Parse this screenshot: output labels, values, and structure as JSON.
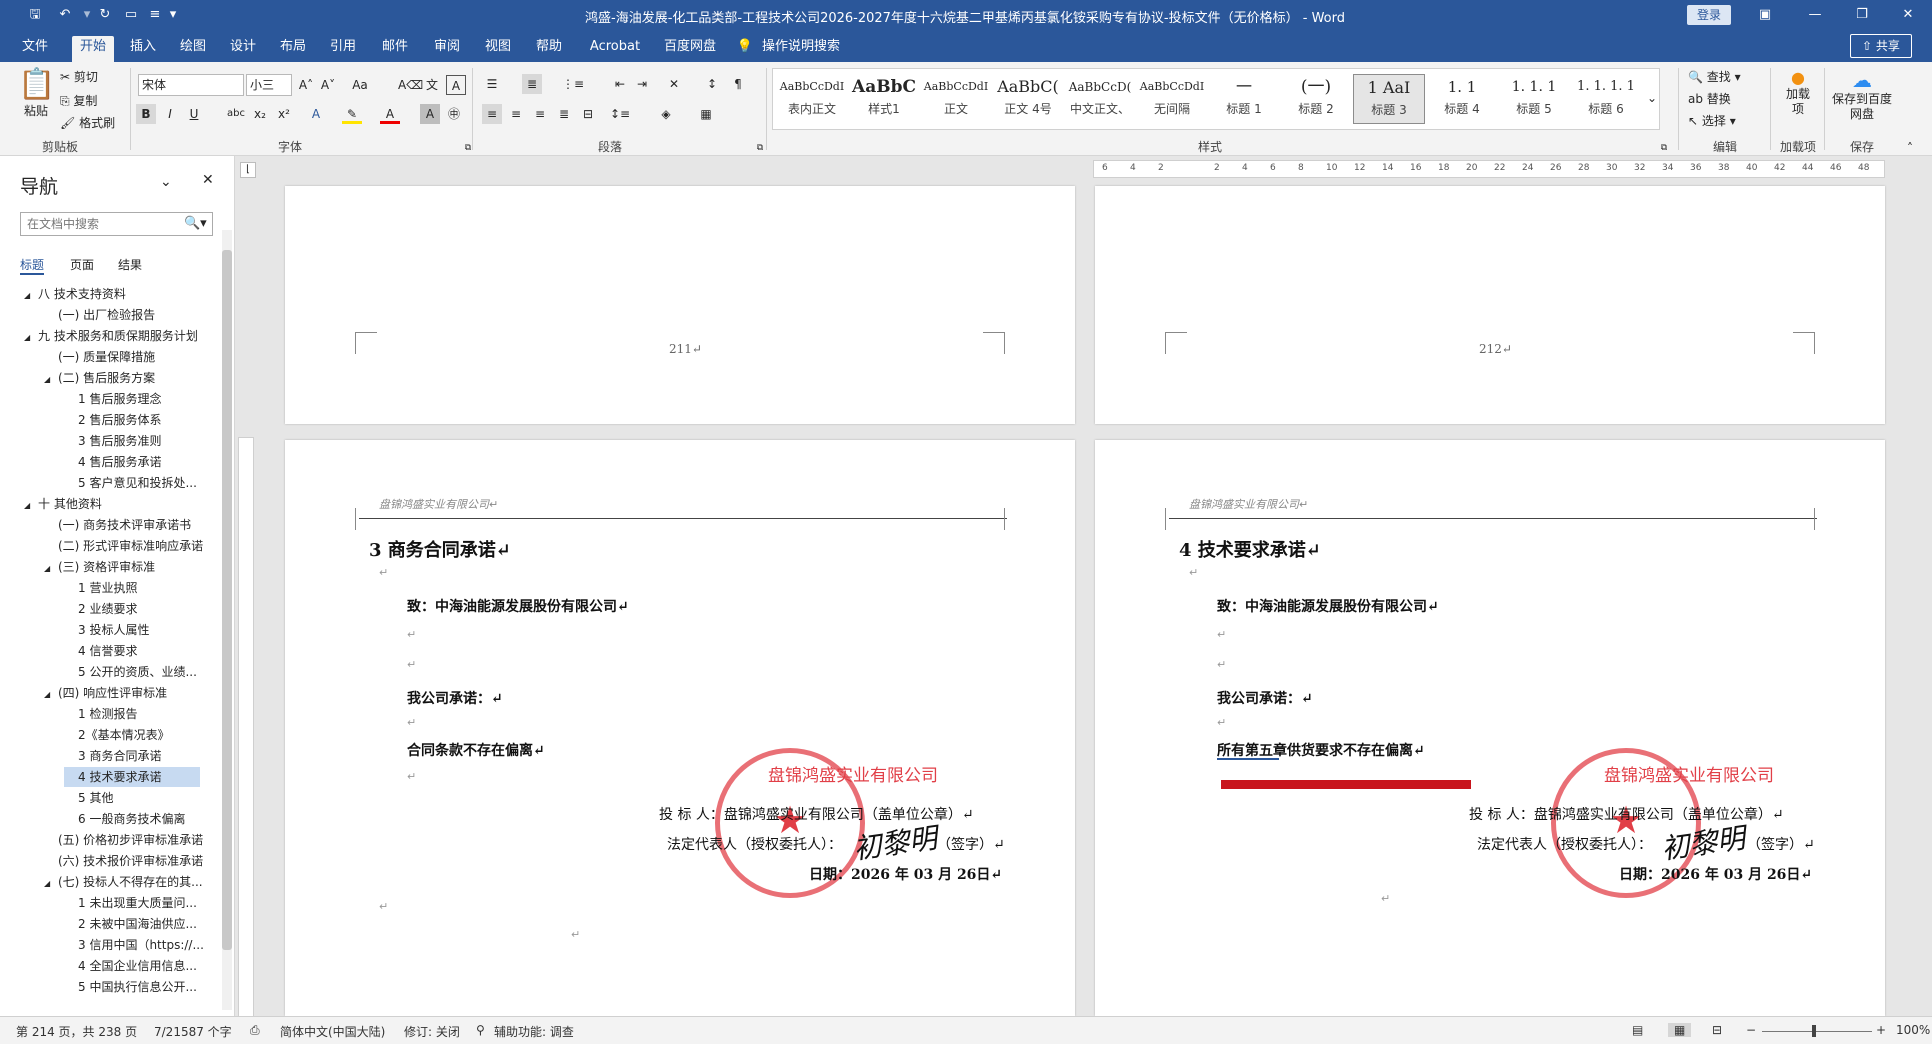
{
  "titlebar": {
    "title": "鸿盛-海油发展-化工品类部-工程技术公司2026-2027年度十六烷基二甲基烯丙基氯化铵采购专有协议-投标文件（无价格标） - Word",
    "login": "登录"
  },
  "tabs": [
    "文件",
    "开始",
    "插入",
    "绘图",
    "设计",
    "布局",
    "引用",
    "邮件",
    "审阅",
    "视图",
    "帮助",
    "Acrobat",
    "百度网盘"
  ],
  "tell_me": "操作说明搜索",
  "share": "共享",
  "clipboard": {
    "paste": "粘贴",
    "cut": "剪切",
    "copy": "复制",
    "format_painter": "格式刷",
    "label": "剪贴板"
  },
  "font": {
    "name": "宋体",
    "size": "小三",
    "label": "字体"
  },
  "paragraph": {
    "label": "段落"
  },
  "styles": {
    "label": "样式",
    "items": [
      {
        "sample": "AaBbCcDdI",
        "name": "表内正文"
      },
      {
        "sample": "AaBbC",
        "name": "样式1"
      },
      {
        "sample": "AaBbCcDdI",
        "name": "正文"
      },
      {
        "sample": "AaBbC(",
        "name": "正文 4号"
      },
      {
        "sample": "AaBbCcD(",
        "name": "中文正文、"
      },
      {
        "sample": "AaBbCcDdI",
        "name": "无间隔"
      },
      {
        "sample": "一",
        "name": "标题 1"
      },
      {
        "sample": "(一)",
        "name": "标题 2"
      },
      {
        "sample": "1  AaI",
        "name": "标题 3"
      },
      {
        "sample": "1. 1",
        "name": "标题 4"
      },
      {
        "sample": "1. 1. 1",
        "name": "标题 5"
      },
      {
        "sample": "1. 1. 1. 1",
        "name": "标题 6"
      }
    ]
  },
  "editing": {
    "find": "查找",
    "replace": "替换",
    "select": "选择",
    "label": "编辑"
  },
  "addins": {
    "name": "加载项",
    "label": "加载项"
  },
  "baidu": {
    "name": "保存到百度网盘",
    "label": "保存"
  },
  "nav": {
    "title": "导航",
    "search_placeholder": "在文档中搜索",
    "tabs": [
      "标题",
      "页面",
      "结果"
    ],
    "tree": [
      {
        "text": "八 技术支持资料",
        "indent": 0,
        "exp": "◢"
      },
      {
        "text": "(一) 出厂检验报告",
        "indent": 1,
        "exp": ""
      },
      {
        "text": "九 技术服务和质保期服务计划",
        "indent": 0,
        "exp": "◢"
      },
      {
        "text": "(一) 质量保障措施",
        "indent": 1,
        "exp": ""
      },
      {
        "text": "(二) 售后服务方案",
        "indent": 1,
        "exp": "◢"
      },
      {
        "text": "1 售后服务理念",
        "indent": 2,
        "exp": ""
      },
      {
        "text": "2 售后服务体系",
        "indent": 2,
        "exp": ""
      },
      {
        "text": "3 售后服务准则",
        "indent": 2,
        "exp": ""
      },
      {
        "text": "4 售后服务承诺",
        "indent": 2,
        "exp": ""
      },
      {
        "text": "5 客户意见和投拆处...",
        "indent": 2,
        "exp": ""
      },
      {
        "text": "十 其他资料",
        "indent": 0,
        "exp": "◢"
      },
      {
        "text": "(一) 商务技术评审承诺书",
        "indent": 1,
        "exp": ""
      },
      {
        "text": "(二) 形式评审标准响应承诺",
        "indent": 1,
        "exp": ""
      },
      {
        "text": "(三) 资格评审标准",
        "indent": 1,
        "exp": "◢"
      },
      {
        "text": "1 营业执照",
        "indent": 2,
        "exp": ""
      },
      {
        "text": "2 业绩要求",
        "indent": 2,
        "exp": ""
      },
      {
        "text": "3 投标人属性",
        "indent": 2,
        "exp": ""
      },
      {
        "text": "4 信誉要求",
        "indent": 2,
        "exp": ""
      },
      {
        "text": "5 公开的资质、业绩...",
        "indent": 2,
        "exp": ""
      },
      {
        "text": "(四) 响应性评审标准",
        "indent": 1,
        "exp": "◢"
      },
      {
        "text": "1 检测报告",
        "indent": 2,
        "exp": ""
      },
      {
        "text": "2《基本情况表》",
        "indent": 2,
        "exp": ""
      },
      {
        "text": "3 商务合同承诺",
        "indent": 2,
        "exp": ""
      },
      {
        "text": "4 技术要求承诺",
        "indent": 2,
        "exp": "",
        "selected": true
      },
      {
        "text": "5 其他",
        "indent": 2,
        "exp": ""
      },
      {
        "text": "6 一般商务技术偏离",
        "indent": 2,
        "exp": ""
      },
      {
        "text": "(五) 价格初步评审标准承诺",
        "indent": 1,
        "exp": ""
      },
      {
        "text": "(六) 技术报价评审标准承诺",
        "indent": 1,
        "exp": ""
      },
      {
        "text": "(七) 投标人不得存在的其...",
        "indent": 1,
        "exp": "◢"
      },
      {
        "text": "1 未出现重大质量问...",
        "indent": 2,
        "exp": ""
      },
      {
        "text": "2 未被中国海油供应...",
        "indent": 2,
        "exp": ""
      },
      {
        "text": "3 信用中国（https://...",
        "indent": 2,
        "exp": ""
      },
      {
        "text": "4 全国企业信用信息...",
        "indent": 2,
        "exp": ""
      },
      {
        "text": "5 中国执行信息公开...",
        "indent": 2,
        "exp": ""
      }
    ]
  },
  "pages": {
    "left_top_num": "211↵",
    "right_top_num": "212↵",
    "header_text": "盘锦鸿盛实业有限公司↵",
    "left": {
      "heading": "3   商务合同承诺↵",
      "to": "致：中海油能源发展股份有限公司↵",
      "promise": "我公司承诺：↵",
      "body": "合同条款不存在偏离↵",
      "bidder": "投   标   人：盘锦鸿盛实业有限公司（盖单位公章）↵",
      "legal": "法定代表人（授权委托人）：",
      "sign_label": "（签字）↵",
      "date": "日期：2026 年 03 月 26日↵"
    },
    "right": {
      "heading": "4   技术要求承诺↵",
      "to": "致：中海油能源发展股份有限公司↵",
      "promise": "我公司承诺：↵",
      "body": "所有第五章供货要求不存在偏离↵",
      "bidder": "投   标   人：盘锦鸿盛实业有限公司（盖单位公章）↵",
      "legal": "法定代表人（授权委托人）：",
      "sign_label": "（签字）↵",
      "date": "日期：2026 年 03 月 26日↵"
    },
    "signature": "初黎明",
    "seal_text": "盘锦鸿盛实业有限公司"
  },
  "ruler_ticks": [
    "6",
    "4",
    "2",
    "",
    "2",
    "4",
    "6",
    "8",
    "10",
    "12",
    "14",
    "16",
    "18",
    "20",
    "22",
    "24",
    "26",
    "28",
    "30",
    "32",
    "34",
    "36",
    "38",
    "40",
    "42",
    "44",
    "46",
    "48"
  ],
  "status": {
    "page": "第 214 页，共 238 页",
    "words": "7/21587 个字",
    "lang": "简体中文(中国大陆)",
    "track": "修订: 关闭",
    "access": "辅助功能: 调查",
    "zoom": "100%"
  },
  "colors": {
    "brand": "#2b579a",
    "seal": "#dc1e28",
    "accent_red": "#c8151d"
  }
}
